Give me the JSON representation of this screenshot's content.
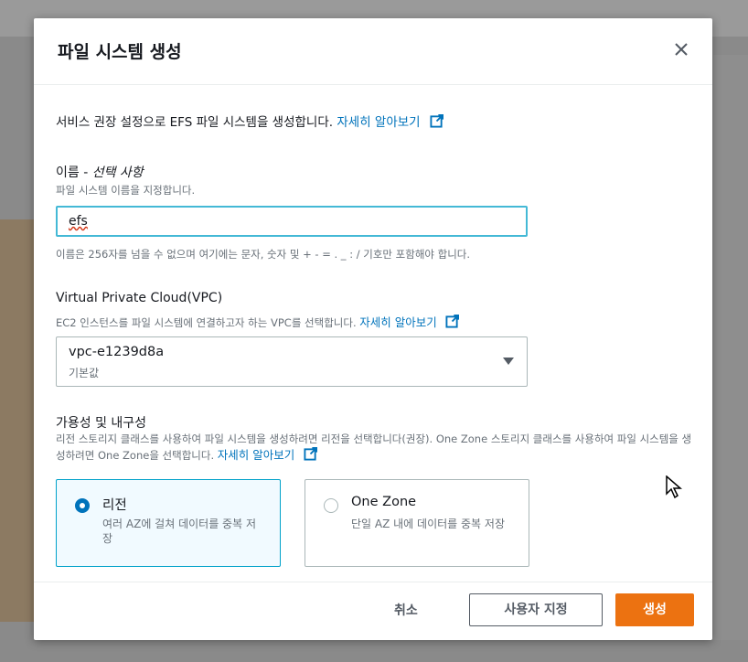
{
  "modal": {
    "title": "파일 시스템 생성",
    "intro_text": "서비스 권장 설정으로 EFS 파일 시스템을 생성합니다.",
    "intro_link": "자세히 알아보기"
  },
  "name_field": {
    "label": "이름 - ",
    "label_optional": "선택 사항",
    "description": "파일 시스템 이름을 지정합니다.",
    "value": "efs",
    "hint": "이름은 256자를 넘을 수 없으며 여기에는 문자, 숫자 및 + - = . _ : / 기호만 포함해야 합니다."
  },
  "vpc_field": {
    "label": "Virtual Private Cloud(VPC)",
    "description": "EC2 인스턴스를 파일 시스템에 연결하고자 하는 VPC를 선택합니다.",
    "link": "자세히 알아보기",
    "selected_value": "vpc-e1239d8a",
    "selected_sub": "기본값"
  },
  "availability": {
    "label": "가용성 및 내구성",
    "description": "리전 스토리지 클래스를 사용하여 파일 시스템을 생성하려면 리전을 선택합니다(권장). One Zone 스토리지 클래스를 사용하여 파일 시스템을 생성하려면 One Zone을 선택합니다.",
    "link": "자세히 알아보기",
    "options": [
      {
        "title": "리전",
        "description": "여러 AZ에 걸쳐 데이터를 중복 저장",
        "selected": true
      },
      {
        "title": "One Zone",
        "description": "단일 AZ 내에 데이터를 중복 저장",
        "selected": false
      }
    ]
  },
  "footer": {
    "cancel": "취소",
    "customize": "사용자 지정",
    "create": "생성"
  },
  "colors": {
    "accent_blue": "#0073bb",
    "primary_orange": "#ec7211",
    "focus_border": "#44b9d6"
  }
}
